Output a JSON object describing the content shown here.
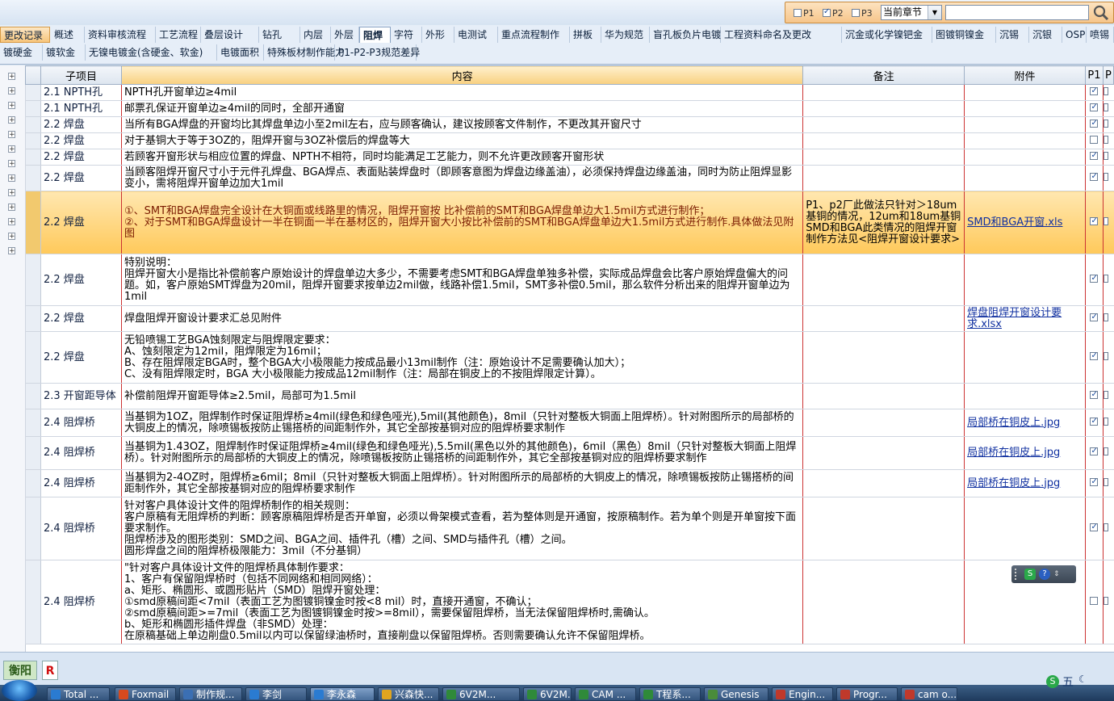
{
  "search_panel": {
    "p1_label": "P1",
    "p1_checked": false,
    "p2_label": "P2",
    "p2_checked": true,
    "p3_label": "P3",
    "p3_checked": false,
    "chapter_value": "当前章节",
    "search_value": ""
  },
  "tabs_row1": [
    "更改记录",
    "概述",
    "资料审核流程",
    "工艺流程",
    "叠层设计",
    "钻孔",
    "内层",
    "外层",
    "阻焊",
    "字符",
    "外形",
    "电测试",
    "重点流程制作",
    "拼板",
    "华为规范",
    "盲孔板负片电镀",
    "工程资料命名及更改",
    "沉金或化学镍钯金",
    "图镀铜镍金",
    "沉锡",
    "沉银",
    "OSP",
    "喷锡"
  ],
  "tabs_row2": [
    "镀硬金",
    "镀软金",
    "无镍电镀金(含硬金、软金)",
    "电镀面积",
    "特殊板材制作能力",
    "P1-P2-P3规范差异"
  ],
  "active_tab": "阻焊",
  "grid": {
    "headers": {
      "sub": "子项目",
      "content": "内容",
      "remark": "备注",
      "attach": "附件",
      "p1": "P1",
      "p2": "P"
    },
    "rows": [
      {
        "sub": "2.1 NPTH孔",
        "content": "NPTH孔开窗单边≥4mil",
        "remark": "",
        "attach": "",
        "p1": true
      },
      {
        "sub": "2.1 NPTH孔",
        "content": "邮票孔保证开窗单边≥4mil的同时，全部开通窗",
        "remark": "",
        "attach": "",
        "p1": true
      },
      {
        "sub": "2.2 焊盘",
        "content": "当所有BGA焊盘的开窗均比其焊盘单边小至2mil左右，应与顾客确认，建议按顾客文件制作，不更改其开窗尺寸",
        "remark": "",
        "attach": "",
        "p1": true
      },
      {
        "sub": "2.2 焊盘",
        "content": "对于基铜大于等于3OZ的，阻焊开窗与3OZ补偿后的焊盘等大",
        "remark": "",
        "attach": "",
        "p1": false
      },
      {
        "sub": "2.2 焊盘",
        "content": "若顾客开窗形状与相应位置的焊盘、NPTH不相符，同时均能满足工艺能力，则不允许更改顾客开窗形状",
        "remark": "",
        "attach": "",
        "p1": true
      },
      {
        "sub": "2.2 焊盘",
        "content": "当顾客阻焊开窗尺寸小于元件孔焊盘、BGA焊点、表面贴装焊盘时（即顾客意图为焊盘边缘盖油），必须保持焊盘边缘盖油，同时为防止阻焊显影变小，需将阻焊开窗单边加大1mil",
        "remark": "",
        "attach": "",
        "p1": true
      },
      {
        "sub": "2.2 焊盘",
        "content": "①、SMT和BGA焊盘完全设计在大铜面或线路里的情况，阻焊开窗按 比补偿前的SMT和BGA焊盘单边大1.5mil方式进行制作；\n②、对于SMT和BGA焊盘设计一半在铜面一半在基材区的，阻焊开窗大小按比补偿前的SMT和BGA焊盘单边大1.5mil方式进行制作.具体做法见附图",
        "remark": "P1、p2厂此做法只针对＞18um基铜的情况，12um和18um基铜SMD和BGA此类情况的阻焊开窗制作方法见<阻焊开窗设计要求>",
        "attach": "SMD和BGA开窗.xls",
        "p1": true
      },
      {
        "sub": "2.2 焊盘",
        "content": "特别说明：\n阻焊开窗大小是指比补偿前客户原始设计的焊盘单边大多少，不需要考虑SMT和BGA焊盘单独多补偿，实际成品焊盘会比客户原始焊盘偏大的问题。如，客户原始SMT焊盘为20mil，阻焊开窗要求按单边2mil做，线路补偿1.5mil，SMT多补偿0.5mil，那么软件分析出来的阻焊开窗单边为1mil",
        "remark": "",
        "attach": "",
        "p1": true
      },
      {
        "sub": "2.2 焊盘",
        "content": "焊盘阻焊开窗设计要求汇总见附件",
        "remark": "",
        "attach": "焊盘阻焊开窗设计要求.xlsx",
        "p1": true
      },
      {
        "sub": "2.2 焊盘",
        "content": "无铅喷锡工艺BGA蚀刻限定与阻焊限定要求：\nA、蚀刻限定为12mil，阻焊限定为16mil；\nB、存在阻焊限定BGA时，整个BGA大小极限能力按成品最小13mil制作（注：原始设计不足需要确认加大）；\nC、没有阻焊限定时，BGA 大小极限能力按成品12mil制作（注：局部在铜皮上的不按阻焊限定计算）。",
        "remark": "",
        "attach": "",
        "p1": true
      },
      {
        "sub": "2.3 开窗距导体",
        "content": "补偿前阻焊开窗距导体≥2.5mil，局部可为1.5mil",
        "remark": "",
        "attach": "",
        "p1": true
      },
      {
        "sub": "2.4 阻焊桥",
        "content": "当基铜为1OZ，阻焊制作时保证阻焊桥≥4mil(绿色和绿色哑光),5mil(其他颜色)，8mil（只针对整板大铜面上阻焊桥）。针对附图所示的局部桥的大铜皮上的情况，除喷锡板按防止锡搭桥的间距制作外，其它全部按基铜对应的阻焊桥要求制作",
        "remark": "",
        "attach": "局部桥在铜皮上.jpg",
        "p1": true
      },
      {
        "sub": "2.4 阻焊桥",
        "content": "当基铜为1.43OZ，阻焊制作时保证阻焊桥≥4mil(绿色和绿色哑光),5.5mil(黑色以外的其他颜色)，6mil（黑色）8mil（只针对整板大铜面上阻焊桥）。针对附图所示的局部桥的大铜皮上的情况，除喷锡板按防止锡搭桥的间距制作外，其它全部按基铜对应的阻焊桥要求制作",
        "remark": "",
        "attach": "局部桥在铜皮上.jpg",
        "p1": true
      },
      {
        "sub": "2.4 阻焊桥",
        "content": "当基铜为2-4OZ时，阻焊桥≥6mil；8mil（只针对整板大铜面上阻焊桥）。针对附图所示的局部桥的大铜皮上的情况，除喷锡板按防止锡搭桥的间距制作外，其它全部按基铜对应的阻焊桥要求制作",
        "remark": "",
        "attach": "局部桥在铜皮上.jpg",
        "p1": true
      },
      {
        "sub": "2.4 阻焊桥",
        "content": "针对客户具体设计文件的阻焊桥制作的相关规则：\n客户原稿有无阻焊桥的判断：顾客原稿阻焊桥是否开单窗，必须以骨架模式查看，若为整体则是开通窗，按原稿制作。若为单个则是开单窗按下面要求制作。\n阻焊桥涉及的图形类别：SMD之间、BGA之间、插件孔（槽）之间、SMD与插件孔（槽）之间。\n圆形焊盘之间的阻焊桥极限能力：3mil（不分基铜）",
        "remark": "",
        "attach": "",
        "p1": true
      },
      {
        "sub": "2.4 阻焊桥",
        "content": "\"针对客户具体设计文件的阻焊桥具体制作要求：\n1、客户有保留阻焊桥时（包括不同网络和相同网络）：\na、矩形、椭圆形、或圆形贴片（SMD）阻焊开窗处理：\n①smd原稿间距<7mil（表面工艺为图镀铜镍金时按<8 mil）时，直接开通窗，不确认；\n②smd原稿间距>=7mil（表面工艺为图镀铜镍金时按>=8mil），需要保留阻焊桥，当无法保留阻焊桥时,需确认。\nb、矩形和椭圆形插件焊盘（非SMD）处理：\n在原稿基础上单边削盘0.5mil以内可以保留绿油桥时，直接削盘以保留阻焊桥。否则需要确认允许不保留阻焊桥。",
        "remark": "",
        "attach": "",
        "p1": false
      }
    ]
  },
  "status": {
    "left_label": "衡阳",
    "r_label": "R"
  },
  "taskbar": [
    {
      "label": "Total ...",
      "color": "#2a7bd1"
    },
    {
      "label": "Foxmail",
      "color": "#d64a1e"
    },
    {
      "label": "制作规...",
      "color": "#3b6fb3"
    },
    {
      "label": "李剑",
      "color": "#2a7bd1"
    },
    {
      "label": "李永森",
      "color": "#2a7bd1"
    },
    {
      "label": "兴森快...",
      "color": "#e0a520"
    },
    {
      "label": "6V2M...",
      "color": "#2f8a3a"
    },
    {
      "label": "6V2M...",
      "color": "#2f8a3a"
    },
    {
      "label": "CAM ...",
      "color": "#2f8a3a"
    },
    {
      "label": "T程系...",
      "color": "#2f8a3a"
    },
    {
      "label": "Genesis",
      "color": "#4a8c3a"
    },
    {
      "label": "Engin...",
      "color": "#c0392b"
    },
    {
      "label": "Progr...",
      "color": "#c0392b"
    },
    {
      "label": "cam o...",
      "color": "#c0392b"
    }
  ],
  "tray": {
    "ime": "五"
  }
}
